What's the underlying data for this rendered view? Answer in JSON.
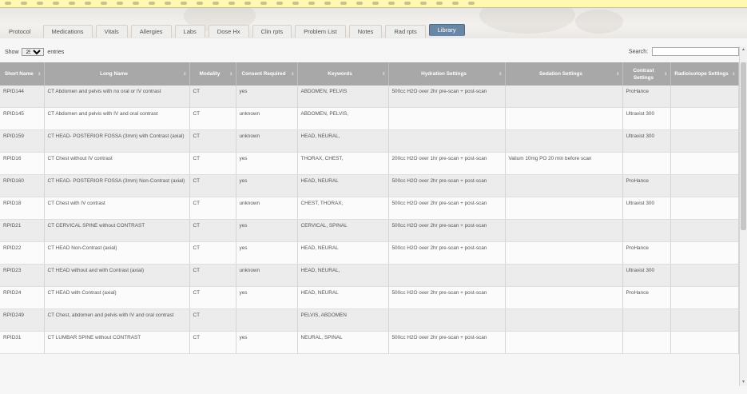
{
  "tabs": [
    {
      "label": "Protocol"
    },
    {
      "label": "Medications"
    },
    {
      "label": "Vitals"
    },
    {
      "label": "Allergies"
    },
    {
      "label": "Labs"
    },
    {
      "label": "Dose Hx"
    },
    {
      "label": "Clin rpts"
    },
    {
      "label": "Problem List"
    },
    {
      "label": "Notes"
    },
    {
      "label": "Rad rpts"
    },
    {
      "label": "Library"
    }
  ],
  "active_tab": "Library",
  "controls": {
    "show_prefix": "Show",
    "show_value": "25",
    "show_suffix": "entries",
    "search_label": "Search:",
    "search_value": ""
  },
  "table": {
    "columns": [
      "Short Name",
      "Long Name",
      "Modality",
      "Consent Required",
      "Keywords",
      "Hydration Settings",
      "Sedation Settings",
      "Contrast Settings",
      "Radioisotope Settings"
    ],
    "rows": [
      [
        "RPID144",
        "CT Abdomen and pelvis with no oral or IV contrast",
        "CT",
        "yes",
        "ABDOMEN, PELVIS",
        "500cc H2O over 2hr pre-scan + post-scan",
        "",
        "ProHance",
        ""
      ],
      [
        "RPID145",
        "CT Abdomen and pelvis with IV and oral contrast",
        "CT",
        "unknown",
        "ABDOMEN, PELVIS,",
        "",
        "",
        "Ultravist 300",
        ""
      ],
      [
        "RPID159",
        "CT HEAD- POSTERIOR FOSSA (3mm) with Contrast (axial)",
        "CT",
        "unknown",
        "HEAD, NEURAL,",
        "",
        "",
        "Ultravist 300",
        ""
      ],
      [
        "RPID16",
        "CT Chest without IV contrast",
        "CT",
        "yes",
        "THORAX, CHEST,",
        "200cc H2O over 1hr pre-scan + post-scan",
        "Valium 10mg PO 20 min before scan",
        "",
        ""
      ],
      [
        "RPID160",
        "CT HEAD- POSTERIOR FOSSA (3mm) Non-Contrast (axial)",
        "CT",
        "yes",
        "HEAD, NEURAL",
        "500cc H2O over 2hr pre-scan + post-scan",
        "",
        "ProHance",
        ""
      ],
      [
        "RPID18",
        "CT Chest with IV contrast",
        "CT",
        "unknown",
        "CHEST, THORAX,",
        "500cc H2O over 2hr pre-scan + post-scan",
        "",
        "Ultravist 300",
        ""
      ],
      [
        "RPID21",
        "CT CERVICAL SPINE without CONTRAST",
        "CT",
        "yes",
        "CERVICAL, SPINAL",
        "500cc H2O over 2hr pre-scan + post-scan",
        "",
        "",
        ""
      ],
      [
        "RPID22",
        "CT HEAD Non-Contrast (axial)",
        "CT",
        "yes",
        "HEAD, NEURAL",
        "500cc H2O over 2hr pre-scan + post-scan",
        "",
        "ProHance",
        ""
      ],
      [
        "RPID23",
        "CT HEAD without and with Contrast (axial)",
        "CT",
        "unknown",
        "HEAD, NEURAL,",
        "",
        "",
        "Ultravist 300",
        ""
      ],
      [
        "RPID24",
        "CT HEAD with Contrast (axial)",
        "CT",
        "yes",
        "HEAD, NEURAL",
        "500cc H2O over 2hr pre-scan + post-scan",
        "",
        "ProHance",
        ""
      ],
      [
        "RPID249",
        "CT Chest, abdomen and pelvis with IV and oral contrast",
        "CT",
        "",
        "PELVIS, ABDOMEN",
        "",
        "",
        "",
        ""
      ],
      [
        "RPID31",
        "CT LUMBAR SPINE without CONTRAST",
        "CT",
        "yes",
        "NEURAL, SPINAL",
        "500cc H2O over 2hr pre-scan + post-scan",
        "",
        "",
        ""
      ]
    ]
  }
}
